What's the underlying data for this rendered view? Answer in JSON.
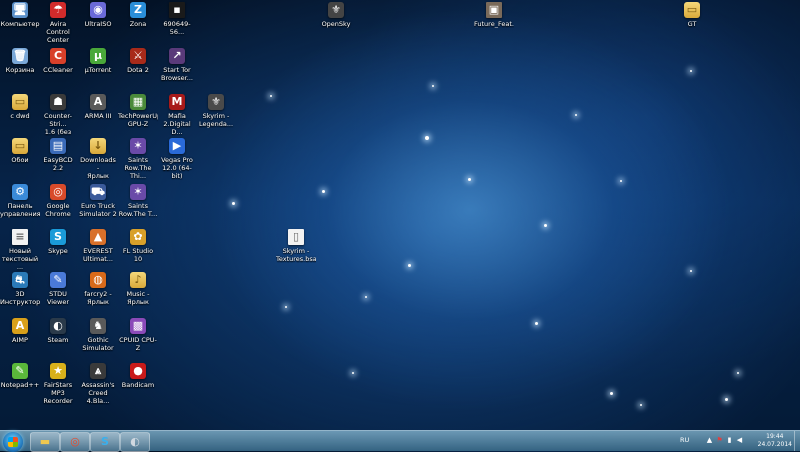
{
  "desktop": {
    "icons": [
      {
        "label": "Компьютер",
        "icon": "computer-icon",
        "glyph": "🖥",
        "color": "#5a8fc8"
      },
      {
        "label": "Avira Control\nCenter",
        "icon": "avira-icon",
        "glyph": "☂",
        "color": "#d22b2b"
      },
      {
        "label": "UltraISO",
        "icon": "ultraiso-icon",
        "glyph": "◉",
        "color": "#6a6ad8"
      },
      {
        "label": "Zona",
        "icon": "zona-icon",
        "glyph": "Z",
        "color": "#2a8ed8"
      },
      {
        "label": "690649-56...",
        "icon": "image-file-icon",
        "glyph": "▪",
        "color": "#1a1a1a"
      },
      {
        "label": "OpenSky",
        "icon": "skyrim-logo-icon",
        "glyph": "⚜",
        "color": "#444444"
      },
      {
        "label": "Future_Feat...",
        "icon": "image-file-icon",
        "glyph": "▣",
        "color": "#7a6a5a"
      },
      {
        "label": "GT",
        "icon": "folder-icon",
        "glyph": "",
        "color": "#e0b84a"
      },
      {
        "label": "Корзина",
        "icon": "recycle-bin-icon",
        "glyph": "🗑",
        "color": "#7aa8d8"
      },
      {
        "label": "CCleaner",
        "icon": "ccleaner-icon",
        "glyph": "C",
        "color": "#d8402a"
      },
      {
        "label": "µTorrent",
        "icon": "utorrent-icon",
        "glyph": "µ",
        "color": "#4aa83a"
      },
      {
        "label": "Dota 2",
        "icon": "dota2-icon",
        "glyph": "⚔",
        "color": "#a82a1a"
      },
      {
        "label": "Start Tor\nBrowser...",
        "icon": "tor-browser-icon",
        "glyph": "↗",
        "color": "#5a3a7a"
      },
      {
        "label": "c dwd",
        "icon": "folder-icon",
        "glyph": "",
        "color": "#e0b84a"
      },
      {
        "label": "Counter-Stri...\n1.6 (без акс...",
        "icon": "counter-strike-icon",
        "glyph": "☗",
        "color": "#3a3a3a"
      },
      {
        "label": "ARMA III",
        "icon": "arma3-icon",
        "glyph": "A",
        "color": "#5a5a5a"
      },
      {
        "label": "TechPowerUp\nGPU-Z",
        "icon": "gpuz-icon",
        "glyph": "▦",
        "color": "#4a8a3a"
      },
      {
        "label": "Mafia\n2.Digital D...",
        "icon": "mafia2-icon",
        "glyph": "M",
        "color": "#a81a1a"
      },
      {
        "label": "Skyrim -\nLegenda...",
        "icon": "skyrim-icon",
        "glyph": "⚜",
        "color": "#4a4a4a"
      },
      {
        "label": "Обои",
        "icon": "folder-icon",
        "glyph": "",
        "color": "#e0b84a"
      },
      {
        "label": "EasyBCD 2.2",
        "icon": "easybcd-icon",
        "glyph": "▤",
        "color": "#3a6ab8"
      },
      {
        "label": "Downloads -\nЯрлык",
        "icon": "downloads-folder-icon",
        "glyph": "",
        "color": "#e0b84a"
      },
      {
        "label": "Saints\nRow.The Thi...",
        "icon": "saints-row-icon",
        "glyph": "✶",
        "color": "#6a4aa8"
      },
      {
        "label": "Vegas Pro\n12.0 (64-bit)",
        "icon": "vegas-pro-icon",
        "glyph": "▶",
        "color": "#2a6ad8"
      },
      {
        "label": "Панель\nуправления",
        "icon": "control-panel-icon",
        "glyph": "⚙",
        "color": "#3a8ad8"
      },
      {
        "label": "Google\nChrome",
        "icon": "chrome-icon",
        "glyph": "◎",
        "color": "#d84a2a"
      },
      {
        "label": "Euro Truck\nSimulator 2",
        "icon": "euro-truck-icon",
        "glyph": "⛟",
        "color": "#3a5a9a"
      },
      {
        "label": "Saints\nRow.The T...",
        "icon": "saints-row-icon",
        "glyph": "✶",
        "color": "#6a4aa8"
      },
      {
        "label": "Новый\nтекстовый ...",
        "icon": "text-document-icon",
        "glyph": "",
        "color": "#f0f0f0"
      },
      {
        "label": "Skype",
        "icon": "skype-icon",
        "glyph": "S",
        "color": "#1a9ad8"
      },
      {
        "label": "EVEREST\nUltimat...",
        "icon": "everest-icon",
        "glyph": "▲",
        "color": "#d8702a"
      },
      {
        "label": "FL Studio 10",
        "icon": "fl-studio-icon",
        "glyph": "✿",
        "color": "#d8a02a"
      },
      {
        "label": "Skyrim -\nTextures.bsa",
        "icon": "bsa-file-icon",
        "glyph": "",
        "color": "#f0f0f0"
      },
      {
        "label": "3D\nИнструктор...",
        "icon": "3d-instructor-icon",
        "glyph": "⛐",
        "color": "#2a7ab8"
      },
      {
        "label": "STDU Viewer",
        "icon": "stdu-viewer-icon",
        "glyph": "✎",
        "color": "#4a7ad8"
      },
      {
        "label": "farcry2 -\nЯрлык",
        "icon": "farcry2-icon",
        "glyph": "◍",
        "color": "#d86a1a"
      },
      {
        "label": "Music -\nЯрлык",
        "icon": "music-folder-icon",
        "glyph": "",
        "color": "#e0b84a"
      },
      {
        "label": "AIMP",
        "icon": "aimp-icon",
        "glyph": "A",
        "color": "#d8a01a"
      },
      {
        "label": "Steam",
        "icon": "steam-icon",
        "glyph": "◐",
        "color": "#2a3a4a"
      },
      {
        "label": "Gothic\nSimulator",
        "icon": "goat-simulator-icon",
        "glyph": "♞",
        "color": "#5a5a5a"
      },
      {
        "label": "CPUID CPU-Z",
        "icon": "cpuz-icon",
        "glyph": "▩",
        "color": "#8a4ab8"
      },
      {
        "label": "Notepad++",
        "icon": "notepad-plus-icon",
        "glyph": "✎",
        "color": "#5ab83a"
      },
      {
        "label": "FairStars MP3\nRecorder",
        "icon": "fairstars-icon",
        "glyph": "★",
        "color": "#d8b01a"
      },
      {
        "label": "Assassin's\nCreed 4.Bla...",
        "icon": "assassins-creed-icon",
        "glyph": "⩓",
        "color": "#3a3a3a"
      },
      {
        "label": "Bandicam",
        "icon": "bandicam-icon",
        "glyph": "●",
        "color": "#c81a1a"
      }
    ]
  },
  "taskbar": {
    "pinned": [
      {
        "name": "explorer-icon",
        "glyph": "📁",
        "color": "#e0b84a"
      },
      {
        "name": "chrome-icon",
        "glyph": "◎",
        "color": "#d84a2a"
      },
      {
        "name": "skype-icon",
        "glyph": "S",
        "color": "#1a9ad8"
      },
      {
        "name": "steam-icon",
        "glyph": "◐",
        "color": "#2a3a4a"
      }
    ],
    "tray": {
      "language": "RU",
      "icons": [
        "chevron-up-icon",
        "flag-icon",
        "network-icon",
        "volume-icon"
      ],
      "time": "19:44",
      "date": "24.07.2014"
    }
  }
}
